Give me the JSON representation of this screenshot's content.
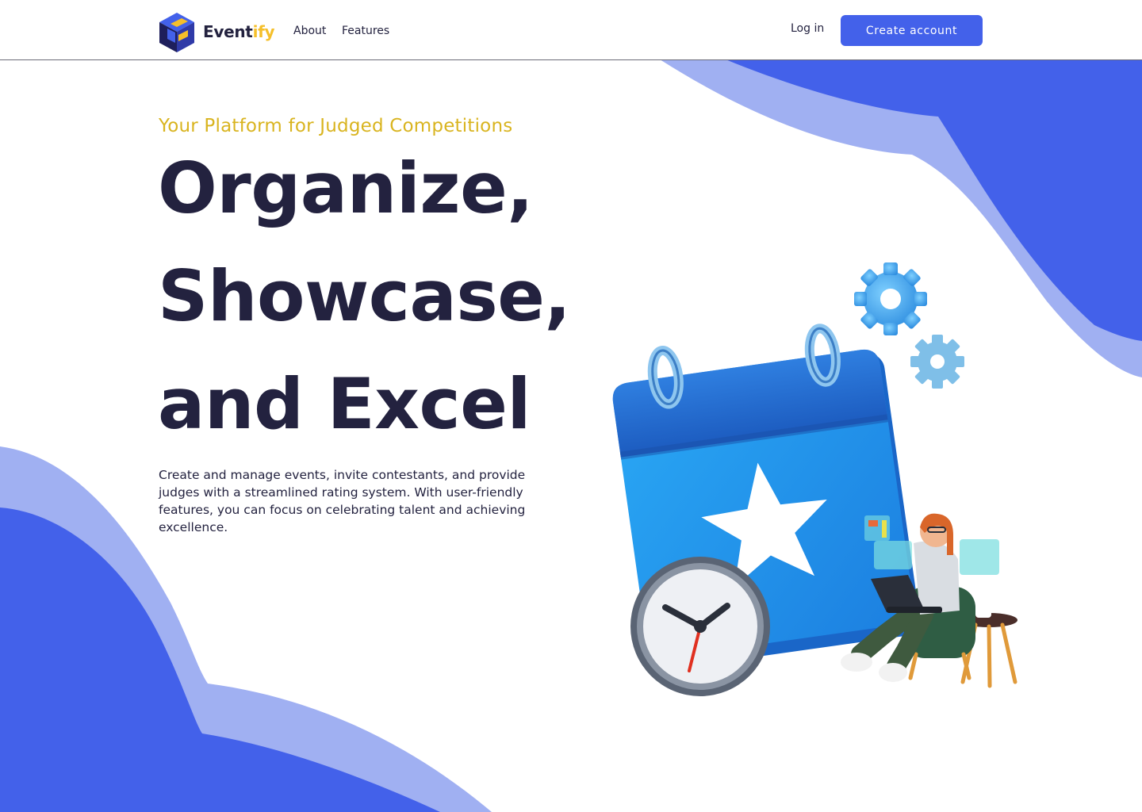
{
  "brand": {
    "name_part1": "Event",
    "name_part2": "ify"
  },
  "nav": {
    "links": [
      {
        "label": "About"
      },
      {
        "label": "Features"
      }
    ],
    "login_label": "Log in",
    "cta_label": "Create account"
  },
  "hero": {
    "tagline": "Your Platform for Judged Competitions",
    "headline_lines": [
      "Organize,",
      "Showcase,",
      "and Excel"
    ],
    "description": "Create and manage events, invite contestants, and provide judges with a streamlined rating system. With user-friendly features, you can focus on celebrating talent and achieving excellence."
  },
  "colors": {
    "primary": "#4361ea",
    "primary_light": "#a0b0f2",
    "accent_yellow": "#d9b41f",
    "heading": "#23223f"
  },
  "icons": {
    "logo": "cube-logo-icon",
    "illustration": "calendar-clock-person-illustration"
  }
}
